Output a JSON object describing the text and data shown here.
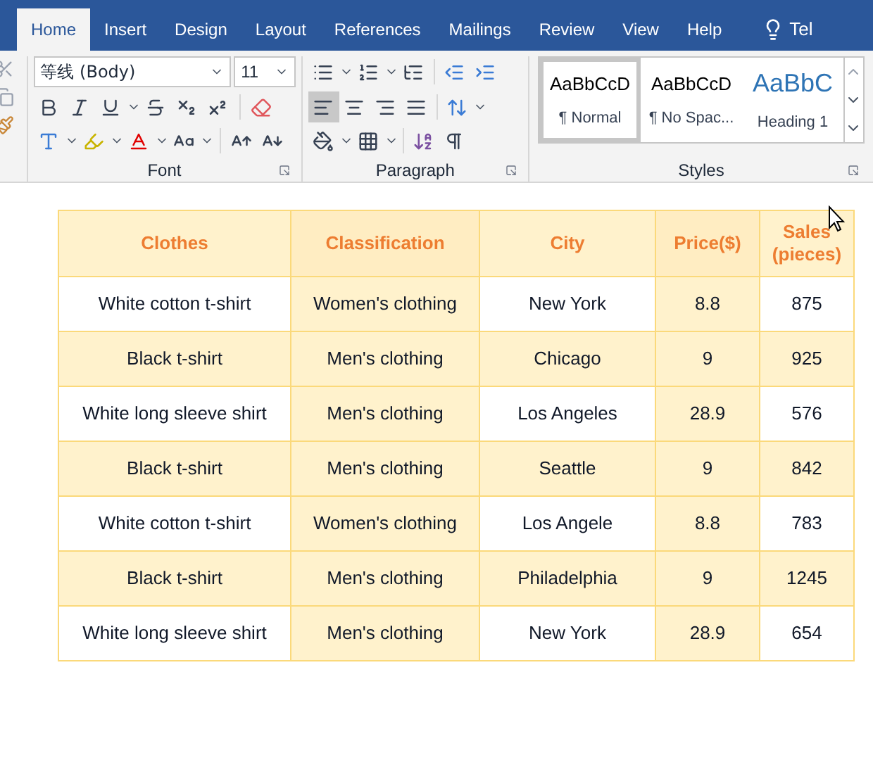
{
  "tabs": [
    {
      "label": "Home",
      "selected": true
    },
    {
      "label": "Insert",
      "selected": false
    },
    {
      "label": "Design",
      "selected": false
    },
    {
      "label": "Layout",
      "selected": false
    },
    {
      "label": "References",
      "selected": false
    },
    {
      "label": "Mailings",
      "selected": false
    },
    {
      "label": "Review",
      "selected": false
    },
    {
      "label": "View",
      "selected": false
    },
    {
      "label": "Help",
      "selected": false
    }
  ],
  "tell_me": "Tel",
  "font_group": {
    "label": "Font",
    "font_name": "等线 (Body)",
    "font_size": "11"
  },
  "paragraph_group": {
    "label": "Paragraph",
    "alignments": [
      {
        "kind": "left",
        "selected": true
      },
      {
        "kind": "center",
        "selected": false
      },
      {
        "kind": "right",
        "selected": false
      },
      {
        "kind": "justify",
        "selected": false
      }
    ]
  },
  "styles_group": {
    "label": "Styles",
    "styles": [
      {
        "kind": "body",
        "sample": "AaBbCcD",
        "name": "¶ Normal",
        "selected": true
      },
      {
        "kind": "body",
        "sample": "AaBbCcD",
        "name": "¶ No Spac...",
        "selected": false
      },
      {
        "kind": "heading",
        "sample": "AaBbC",
        "name": "Heading 1",
        "selected": false
      }
    ]
  },
  "table": {
    "columns": [
      {
        "label": "Clothes",
        "shaded": false
      },
      {
        "label": "Classification",
        "shaded": true
      },
      {
        "label": "City",
        "shaded": false
      },
      {
        "label": "Price($)",
        "shaded": true
      },
      {
        "label": "Sales (pieces)",
        "shaded": false
      }
    ],
    "rows": [
      {
        "banded": false,
        "cells": [
          "White cotton t-shirt",
          "Women's clothing",
          "New York",
          "8.8",
          "875"
        ]
      },
      {
        "banded": true,
        "cells": [
          "Black t-shirt",
          "Men's clothing",
          "Chicago",
          "9",
          "925"
        ]
      },
      {
        "banded": false,
        "cells": [
          "White long sleeve shirt",
          "Men's clothing",
          "Los Angeles",
          "28.9",
          "576"
        ]
      },
      {
        "banded": true,
        "cells": [
          "Black t-shirt",
          "Men's clothing",
          "Seattle",
          "9",
          "842"
        ]
      },
      {
        "banded": false,
        "cells": [
          "White cotton t-shirt",
          "Women's clothing",
          "Los Angele",
          "8.8",
          "783"
        ]
      },
      {
        "banded": true,
        "cells": [
          "Black t-shirt",
          "Men's clothing",
          "Philadelphia",
          "9",
          "1245"
        ]
      },
      {
        "banded": false,
        "cells": [
          "White long sleeve shirt",
          "Men's clothing",
          "New York",
          "28.9",
          "654"
        ]
      }
    ]
  }
}
